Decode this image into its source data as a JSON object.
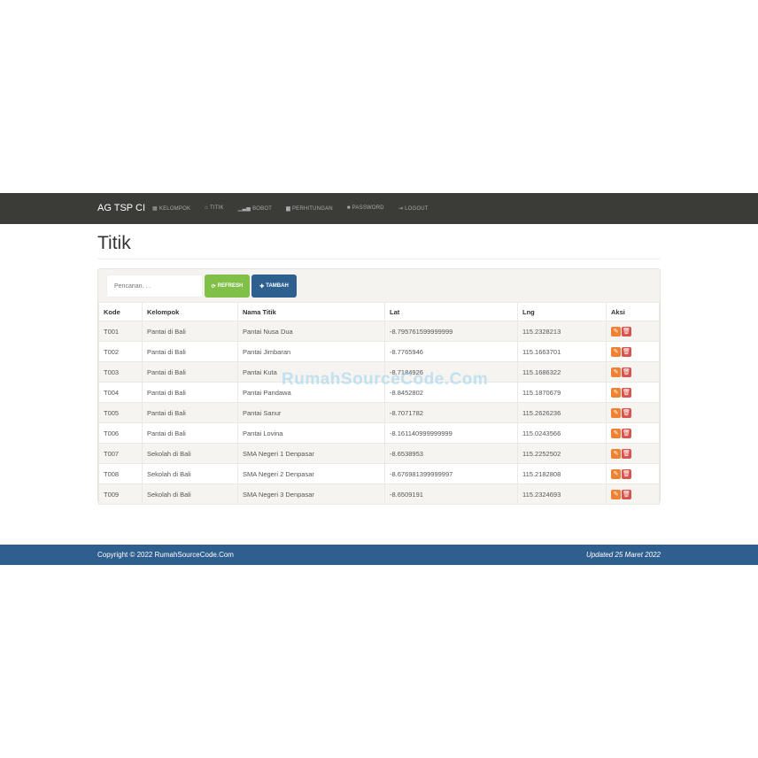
{
  "nav": {
    "brand": "AG TSP CI",
    "items": [
      {
        "label": "KELOMPOK",
        "icon": "th-icon",
        "glyph": "▦"
      },
      {
        "label": "TITIK",
        "icon": "home-icon",
        "glyph": "⌂"
      },
      {
        "label": "BOBOT",
        "icon": "signal-icon",
        "glyph": "▁▃▅"
      },
      {
        "label": "PERHITUNGAN",
        "icon": "bar-chart-icon",
        "glyph": "▆"
      },
      {
        "label": "PASSWORD",
        "icon": "lock-icon",
        "glyph": "■"
      },
      {
        "label": "LOGOUT",
        "icon": "logout-icon",
        "glyph": "⇥"
      }
    ]
  },
  "page": {
    "title": "Titik"
  },
  "toolbar": {
    "search_placeholder": "Pencarian. . .",
    "refresh_label": "REFRESH",
    "tambah_label": "TAMBAH"
  },
  "table": {
    "headers": [
      "Kode",
      "Kelompok",
      "Nama Titik",
      "Lat",
      "Lng",
      "Aksi"
    ],
    "rows": [
      [
        "T001",
        "Pantai di Bali",
        "Pantai Nusa Dua",
        "-8.795761599999999",
        "115.2328213"
      ],
      [
        "T002",
        "Pantai di Bali",
        "Pantai Jimbaran",
        "-8.7765946",
        "115.1663701"
      ],
      [
        "T003",
        "Pantai di Bali",
        "Pantai Kuta",
        "-8.7184926",
        "115.1686322"
      ],
      [
        "T004",
        "Pantai di Bali",
        "Pantai Pandawa",
        "-8.8452802",
        "115.1870679"
      ],
      [
        "T005",
        "Pantai di Bali",
        "Pantai Sanur",
        "-8.7071782",
        "115.2626236"
      ],
      [
        "T006",
        "Pantai di Bali",
        "Pantai Lovina",
        "-8.161140999999999",
        "115.0243566"
      ],
      [
        "T007",
        "Sekolah di Bali",
        "SMA Negeri 1 Denpasar",
        "-8.6538953",
        "115.2252502"
      ],
      [
        "T008",
        "Sekolah di Bali",
        "SMA Negeri 2 Denpasar",
        "-8.676981399999997",
        "115.2182808"
      ],
      [
        "T009",
        "Sekolah di Bali",
        "SMA Negeri 3 Denpasar",
        "-8.6509191",
        "115.2324693"
      ]
    ]
  },
  "watermark": "RumahSourceCode.Com",
  "footer": {
    "copyright": "Copyright © 2022 RumahSourceCode.Com",
    "updated": "Updated 25 Maret 2022"
  }
}
